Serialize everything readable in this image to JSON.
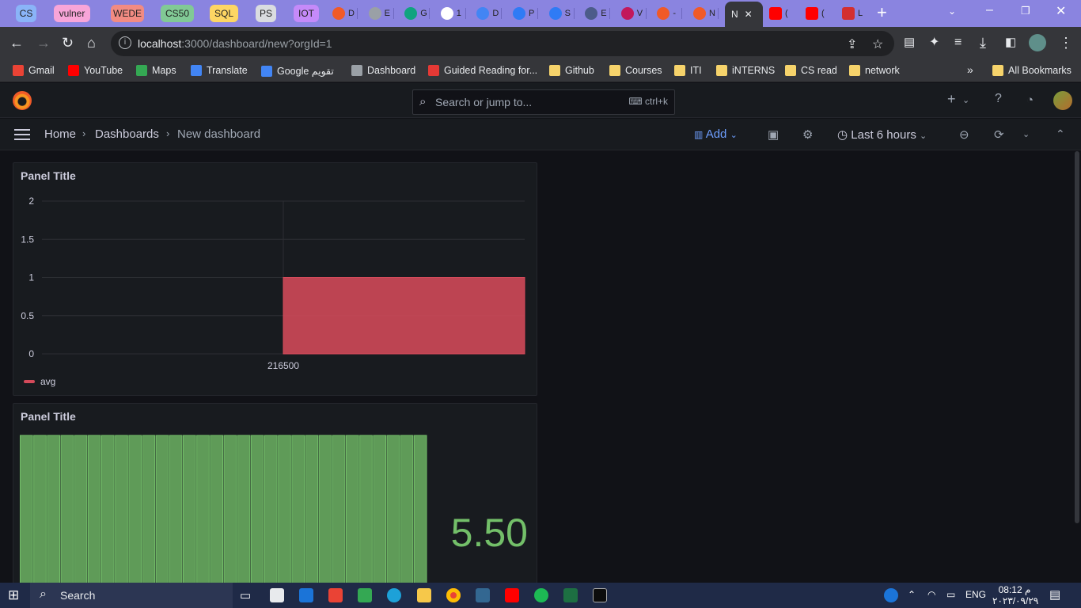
{
  "browser": {
    "tab_groups": [
      {
        "label": "CS",
        "color": "#8ab4f8"
      },
      {
        "label": "vulner",
        "color": "#f8a5d8"
      },
      {
        "label": "WEDE",
        "color": "#f28b82"
      },
      {
        "label": "CS50",
        "color": "#81c995"
      },
      {
        "label": "SQL",
        "color": "#fdd663"
      },
      {
        "label": "PS",
        "color": "#dadce0"
      },
      {
        "label": "IOT",
        "color": "#c58af9"
      }
    ],
    "tabs": [
      {
        "label": "D",
        "color": "#f05a28"
      },
      {
        "label": "E",
        "color": "#9aa0a6"
      },
      {
        "label": "G",
        "color": "#10a37f"
      },
      {
        "label": "1",
        "color": "#ffffff"
      },
      {
        "label": "D",
        "color": "#4285f4"
      },
      {
        "label": "P",
        "color": "#2f7bf5"
      },
      {
        "label": "S",
        "color": "#2f7bf5"
      },
      {
        "label": "E",
        "color": "#4c5c8a"
      },
      {
        "label": "V",
        "color": "#c2185b"
      },
      {
        "label": "-",
        "color": "#f05a28"
      },
      {
        "label": "N",
        "color": "#f05a28"
      }
    ],
    "active_tab": {
      "label": "N"
    },
    "tabs_after": [
      {
        "label": "(",
        "color": "#ff0000"
      },
      {
        "label": "(",
        "color": "#ff0000"
      },
      {
        "label": "L",
        "color": "#d32f2f"
      }
    ],
    "url_host": "localhost",
    "url_rest": ":3000/dashboard/new?orgId=1",
    "bookmarks": [
      {
        "label": "Gmail",
        "color": "#ea4335"
      },
      {
        "label": "YouTube",
        "color": "#ff0000"
      },
      {
        "label": "Maps",
        "color": "#34a853"
      },
      {
        "label": "Translate",
        "color": "#4285f4"
      },
      {
        "label": "Google تقويم",
        "color": "#4285f4"
      },
      {
        "label": "Dashboard",
        "color": "#9aa0a6"
      },
      {
        "label": "Guided Reading for...",
        "color": "#e53935"
      },
      {
        "label": "Github",
        "color": "#f6d36b"
      },
      {
        "label": "Courses",
        "color": "#f6d36b"
      },
      {
        "label": "ITI",
        "color": "#f6d36b"
      },
      {
        "label": "iNTERNS",
        "color": "#f6d36b"
      },
      {
        "label": "CS read",
        "color": "#f6d36b"
      },
      {
        "label": "network",
        "color": "#f6d36b"
      }
    ],
    "more_bookmarks": "»",
    "all_bookmarks": "All Bookmarks"
  },
  "grafana": {
    "search_placeholder": "Search or jump to...",
    "search_shortcut": "ctrl+k",
    "breadcrumb": {
      "home": "Home",
      "dashboards": "Dashboards",
      "current": "New dashboard"
    },
    "add_label": "Add",
    "time_range": "Last 6 hours"
  },
  "panels": [
    {
      "title": "Panel Title",
      "chart_data": {
        "type": "bar",
        "x_boundaries": [
          0,
          216500,
          433000
        ],
        "bar_start": 216500,
        "x_tick": "216500",
        "y_ticks": [
          "2",
          "1.5",
          "1",
          "0.5",
          "0"
        ],
        "ylim": [
          0,
          2
        ],
        "series": [
          {
            "name": "avg",
            "values": [
              1
            ],
            "color": "#d44a5a"
          }
        ],
        "legend_placement": "bottom-left",
        "grid": true
      }
    },
    {
      "title": "Panel Title",
      "stat": {
        "value": "5.50",
        "color": "#73bf69",
        "bar_count": 30
      }
    }
  ],
  "taskbar": {
    "search_label": "Search",
    "language": "ENG",
    "time": "08:12 م",
    "date": "٢٠٢٣/٠٩/٢٩"
  }
}
